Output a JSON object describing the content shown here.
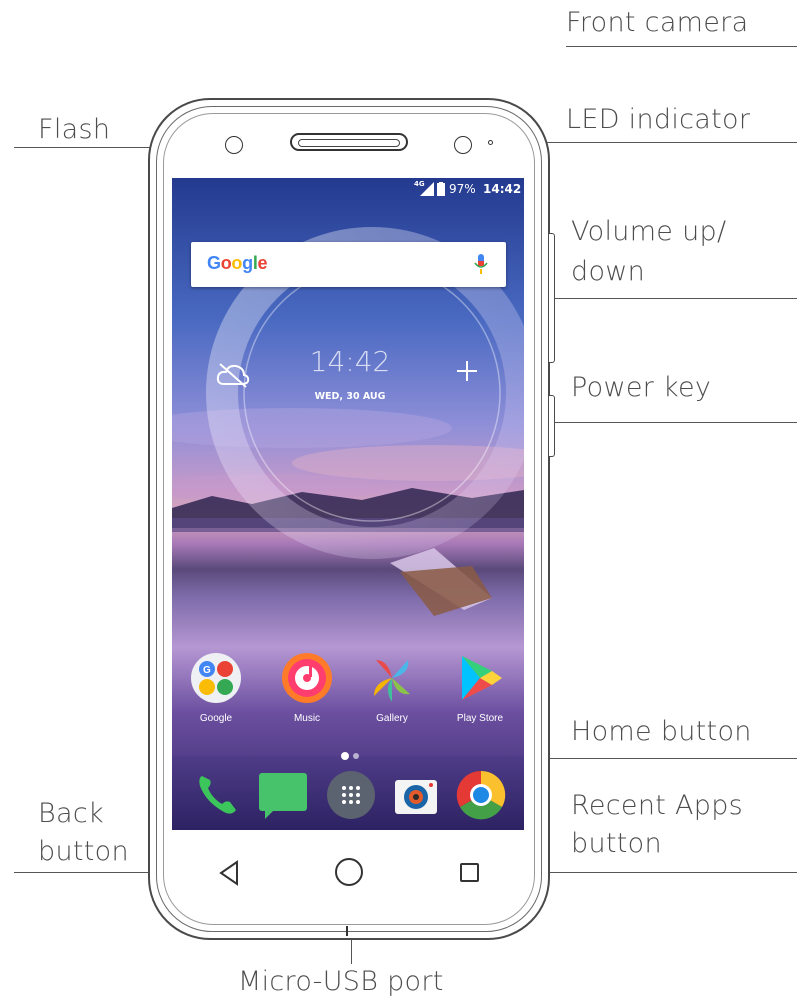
{
  "labels": {
    "front_camera": "Front camera",
    "flash": "Flash",
    "led_indicator": "LED indicator",
    "volume_line1": "Volume up/",
    "volume_line2": "down",
    "power_key": "Power key",
    "home_button": "Home button",
    "back_line1": "Back",
    "back_line2": "button",
    "recent_line1": "Recent Apps",
    "recent_line2": "button",
    "micro_usb": "Micro-USB port"
  },
  "status_bar": {
    "network": "4G",
    "battery": "97%",
    "time": "14:42"
  },
  "search": {
    "brand": "Google"
  },
  "widget": {
    "clock": "14:42",
    "date": "WED, 30 AUG"
  },
  "apps": [
    {
      "label": "Google"
    },
    {
      "label": "Music"
    },
    {
      "label": "Gallery"
    },
    {
      "label": "Play Store"
    }
  ],
  "dock": [
    {
      "name": "phone-icon"
    },
    {
      "name": "messages-icon"
    },
    {
      "name": "app-drawer-icon"
    },
    {
      "name": "camera-icon"
    },
    {
      "name": "chrome-icon"
    }
  ],
  "colors": {
    "text": "#4d4d4d",
    "outline": "#333333",
    "sky_top": "#2d3f8f",
    "sky_mid": "#8a6fc7",
    "dock_bg": "#3b2e6e"
  }
}
